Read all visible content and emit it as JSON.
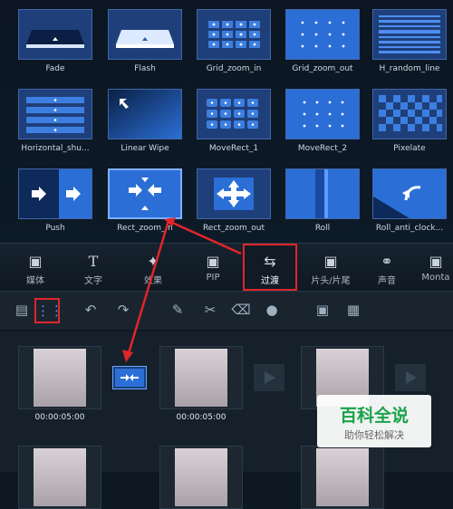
{
  "transitions": [
    {
      "label": "Fade",
      "icon": "fade-icon"
    },
    {
      "label": "Flash",
      "icon": "flash-icon"
    },
    {
      "label": "Grid_zoom_in",
      "icon": "grid-zoom-in-icon"
    },
    {
      "label": "Grid_zoom_out",
      "icon": "grid-zoom-out-icon"
    },
    {
      "label": "H_random_line",
      "icon": "h-random-line-icon"
    },
    {
      "label": "Horizontal_shu...",
      "icon": "horizontal-shutter-icon"
    },
    {
      "label": "Linear Wipe",
      "icon": "linear-wipe-icon"
    },
    {
      "label": "MoveRect_1",
      "icon": "move-rect-1-icon"
    },
    {
      "label": "MoveRect_2",
      "icon": "move-rect-2-icon"
    },
    {
      "label": "Pixelate",
      "icon": "pixelate-icon"
    },
    {
      "label": "Push",
      "icon": "push-icon"
    },
    {
      "label": "Rect_zoom_in",
      "icon": "rect-zoom-in-icon"
    },
    {
      "label": "Rect_zoom_out",
      "icon": "rect-zoom-out-icon"
    },
    {
      "label": "Roll",
      "icon": "roll-icon"
    },
    {
      "label": "Roll_anti_clock...",
      "icon": "roll-anti-clock-icon"
    }
  ],
  "tabs": [
    {
      "label": "媒体",
      "icon": "media-film-icon"
    },
    {
      "label": "文字",
      "icon": "text-t-icon"
    },
    {
      "label": "效果",
      "icon": "effect-wand-icon"
    },
    {
      "label": "PIP",
      "icon": "pip-film-icon"
    },
    {
      "label": "过渡",
      "icon": "transition-icon"
    },
    {
      "label": "片头/片尾",
      "icon": "intro-outro-icon"
    },
    {
      "label": "声音",
      "icon": "headphones-icon"
    },
    {
      "label": "Monta",
      "icon": "montage-icon"
    }
  ],
  "active_tab": "过渡",
  "timeline": {
    "clips": [
      {
        "time": "00:00:05:00"
      },
      {
        "time": "00:00:05:00"
      },
      {
        "time": ""
      }
    ]
  },
  "watermark": {
    "title": "百科全说",
    "subtitle": "助你轻松解决"
  },
  "colors": {
    "accent": "#2a7de1",
    "highlight_box": "#e0262a",
    "panel": "#0d1a27"
  }
}
